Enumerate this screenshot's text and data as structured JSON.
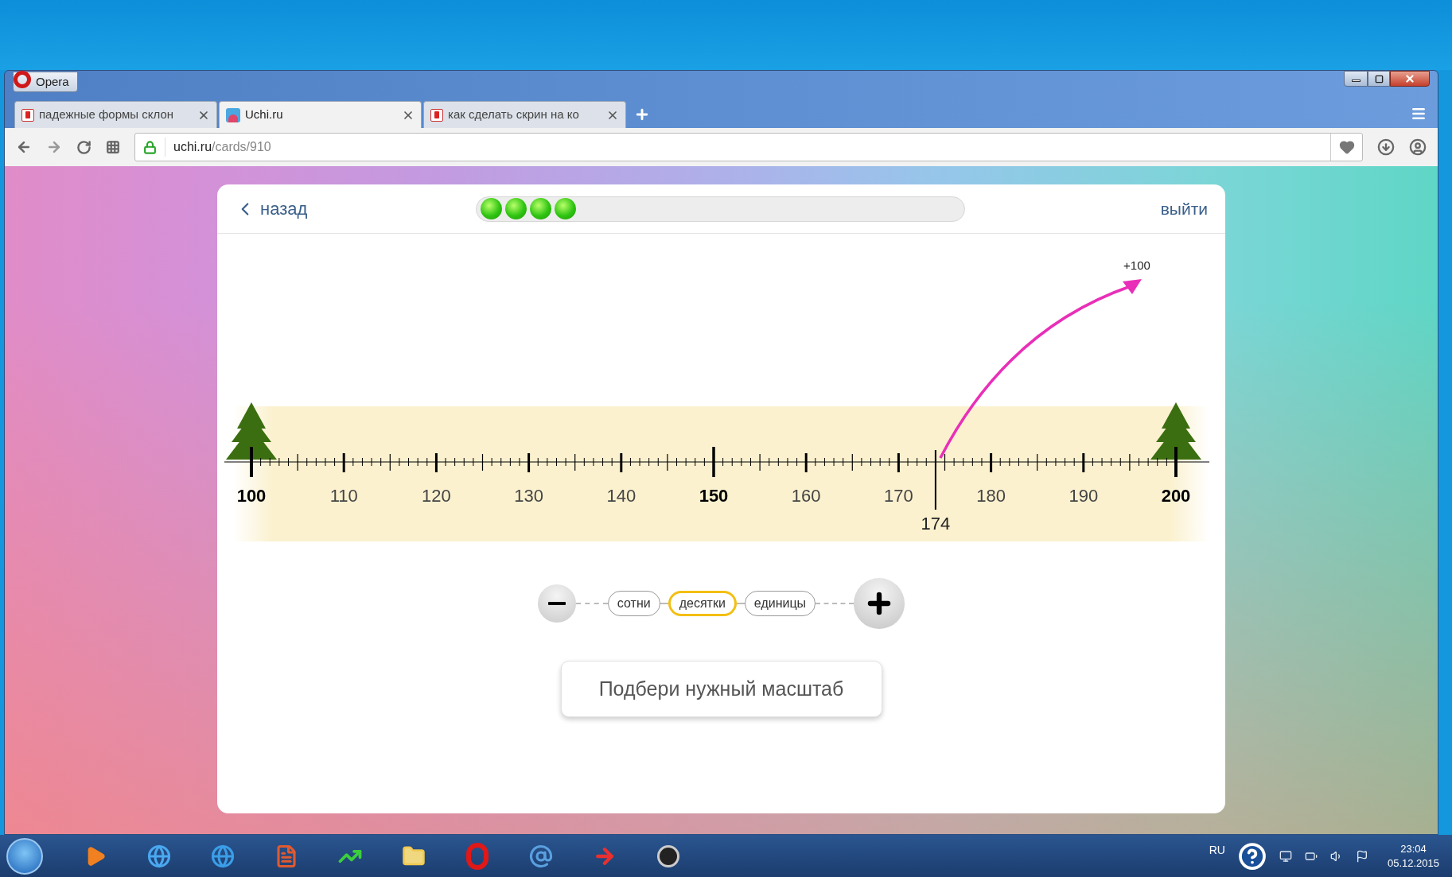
{
  "window": {
    "menu_button": "Opera"
  },
  "tabs": [
    {
      "label": "падежные формы склон",
      "selected": false
    },
    {
      "label": "Uchi.ru",
      "selected": true
    },
    {
      "label": "как сделать скрин на ко",
      "selected": false
    }
  ],
  "address_bar": {
    "host": "uchi.ru",
    "path": "/cards/910"
  },
  "card": {
    "back": "назад",
    "exit": "выйти",
    "steps": [
      {
        "done": true
      },
      {
        "done": true
      },
      {
        "done": true
      },
      {
        "done": true
      }
    ],
    "number_line": {
      "labels": [
        {
          "text": "100",
          "major": true
        },
        {
          "text": "110",
          "major": false
        },
        {
          "text": "120",
          "major": false
        },
        {
          "text": "130",
          "major": false
        },
        {
          "text": "140",
          "major": false
        },
        {
          "text": "150",
          "major": true
        },
        {
          "text": "160",
          "major": false
        },
        {
          "text": "170",
          "major": false
        },
        {
          "text": "180",
          "major": false
        },
        {
          "text": "190",
          "major": false
        },
        {
          "text": "200",
          "major": true
        }
      ],
      "marker": {
        "text": "174",
        "level": 0.74
      },
      "jump_label": "+100"
    },
    "scale_options": [
      {
        "label": "сотни",
        "selected": false
      },
      {
        "label": "десятки",
        "selected": true
      },
      {
        "label": "единицы",
        "selected": false
      }
    ],
    "hint": "Подбери нужный масштаб"
  },
  "taskbar": {
    "language": "RU",
    "time": "23:04",
    "date": "05.12.2015"
  }
}
